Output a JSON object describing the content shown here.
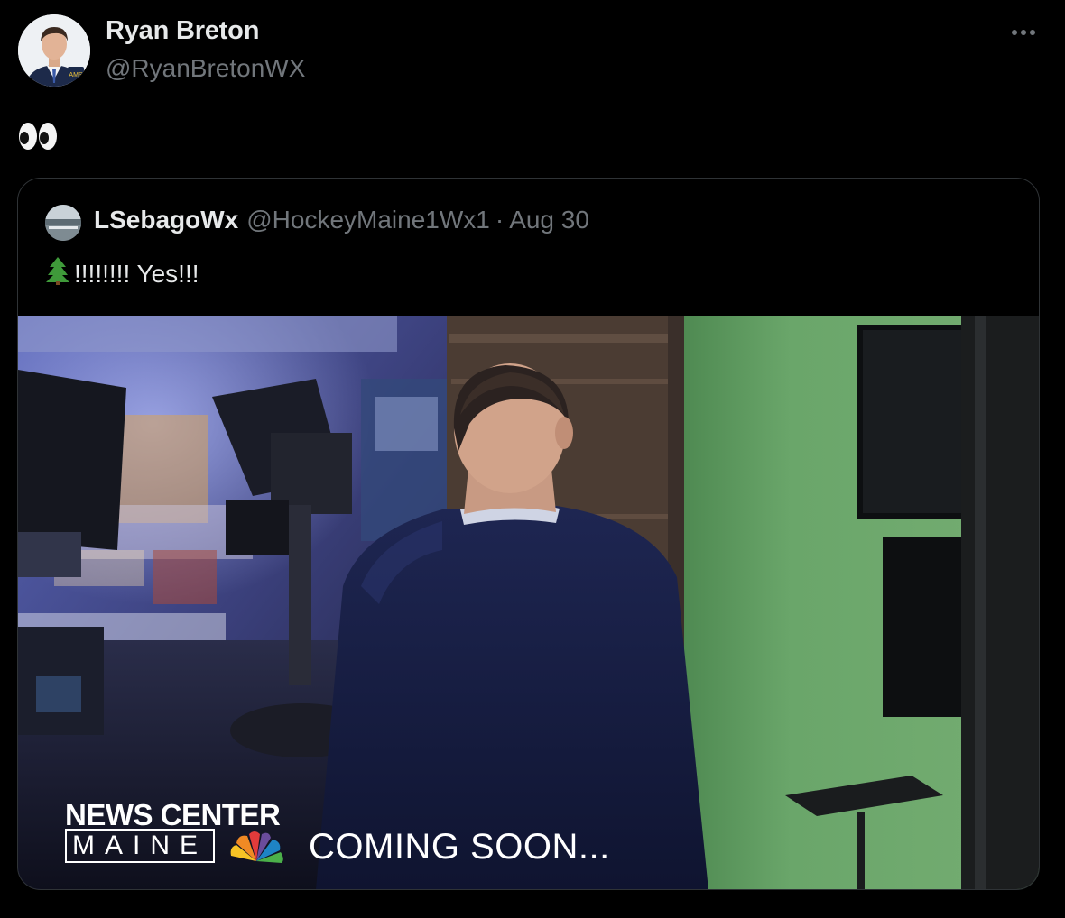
{
  "tweet": {
    "author": {
      "name": "Ryan Breton",
      "handle": "@RyanBretonWX",
      "avatar_badge": "AMS"
    },
    "more_icon": "more-horizontal-icon",
    "text_emoji": "eyes-emoji"
  },
  "quoted_tweet": {
    "author": {
      "name": "LSebagoWx",
      "handle": "@HockeyMaine1Wx1"
    },
    "separator": "·",
    "date": "Aug 30",
    "text": "!!!!!!!! Yes!!!",
    "text_emoji": "evergreen-tree-emoji",
    "media": {
      "description_icon": "video-still",
      "overlay": {
        "brand_line1": "NEWS CENTER",
        "brand_line2": "MAINE",
        "brand_logo": "nbc-peacock-icon",
        "tagline": "COMING SOON..."
      }
    }
  },
  "colors": {
    "background": "#000000",
    "text_primary": "#e7e9ea",
    "text_secondary": "#71767b",
    "border": "#2f3336",
    "green_screen": "#6aa66a"
  }
}
